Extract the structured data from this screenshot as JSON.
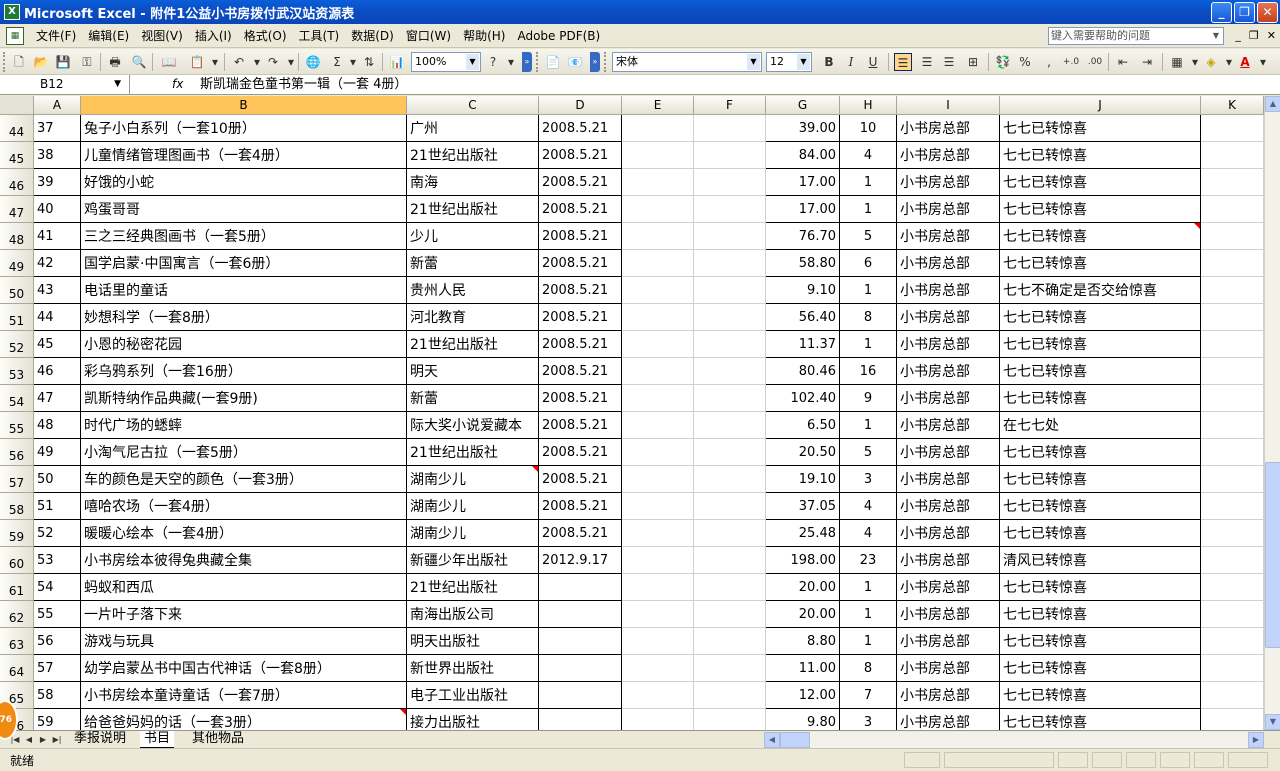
{
  "window": {
    "title": "Microsoft Excel - 附件1公益小书房拨付武汉站资源表",
    "app_icon": "X"
  },
  "menu": {
    "items": [
      "文件(F)",
      "编辑(E)",
      "视图(V)",
      "插入(I)",
      "格式(O)",
      "工具(T)",
      "数据(D)",
      "窗口(W)",
      "帮助(H)",
      "Adobe PDF(B)"
    ],
    "help_placeholder": "键入需要帮助的问题"
  },
  "toolbar": {
    "zoom": "100%",
    "font_name": "宋体",
    "font_size": "12",
    "bold": "B",
    "italic": "I",
    "underline": "U",
    "sum": "Σ",
    "percent": "%",
    "comma": ","
  },
  "formula_bar": {
    "name_box": "B12",
    "fx": "fx",
    "formula": "斯凯瑞金色童书第一辑（一套 4册）"
  },
  "columns": [
    "A",
    "B",
    "C",
    "D",
    "E",
    "F",
    "G",
    "H",
    "I",
    "J",
    "K"
  ],
  "selected_column": "B",
  "rows": [
    {
      "row": "44",
      "a": "37",
      "b": "兔子小白系列（一套10册）",
      "c": "广州",
      "d": "2008.5.21",
      "g": "39.00",
      "h": "10",
      "i": "小书房总部",
      "j": "七七已转惊喜"
    },
    {
      "row": "45",
      "a": "38",
      "b": "儿童情绪管理图画书（一套4册）",
      "c": "21世纪出版社",
      "d": "2008.5.21",
      "g": "84.00",
      "h": "4",
      "i": "小书房总部",
      "j": "七七已转惊喜"
    },
    {
      "row": "46",
      "a": "39",
      "b": "好饿的小蛇",
      "c": "南海",
      "d": "2008.5.21",
      "g": "17.00",
      "h": "1",
      "i": "小书房总部",
      "j": "七七已转惊喜"
    },
    {
      "row": "47",
      "a": "40",
      "b": "鸡蛋哥哥",
      "c": "21世纪出版社",
      "d": "2008.5.21",
      "g": "17.00",
      "h": "1",
      "i": "小书房总部",
      "j": "七七已转惊喜"
    },
    {
      "row": "48",
      "a": "41",
      "b": "三之三经典图画书（一套5册）",
      "c": "少儿",
      "d": "2008.5.21",
      "g": "76.70",
      "h": "5",
      "i": "小书房总部",
      "j": "七七已转惊喜"
    },
    {
      "row": "49",
      "a": "42",
      "b": "国学启蒙·中国寓言（一套6册）",
      "c": "新蕾",
      "d": "2008.5.21",
      "g": "58.80",
      "h": "6",
      "i": "小书房总部",
      "j": "七七已转惊喜"
    },
    {
      "row": "50",
      "a": "43",
      "b": "电话里的童话",
      "c": "贵州人民",
      "d": "2008.5.21",
      "g": "9.10",
      "h": "1",
      "i": "小书房总部",
      "j": "七七不确定是否交给惊喜"
    },
    {
      "row": "51",
      "a": "44",
      "b": "妙想科学（一套8册）",
      "c": "河北教育",
      "d": "2008.5.21",
      "g": "56.40",
      "h": "8",
      "i": "小书房总部",
      "j": "七七已转惊喜"
    },
    {
      "row": "52",
      "a": "45",
      "b": "小恩的秘密花园",
      "c": "21世纪出版社",
      "d": "2008.5.21",
      "g": "11.37",
      "h": "1",
      "i": "小书房总部",
      "j": "七七已转惊喜"
    },
    {
      "row": "53",
      "a": "46",
      "b": "彩乌鸦系列（一套16册）",
      "c": "明天",
      "d": "2008.5.21",
      "g": "80.46",
      "h": "16",
      "i": "小书房总部",
      "j": "七七已转惊喜"
    },
    {
      "row": "54",
      "a": "47",
      "b": "凯斯特纳作品典藏(一套9册)",
      "c": "新蕾",
      "d": "2008.5.21",
      "g": "102.40",
      "h": "9",
      "i": "小书房总部",
      "j": "七七已转惊喜"
    },
    {
      "row": "55",
      "a": "48",
      "b": "时代广场的蟋蟀",
      "c": "际大奖小说爱藏本",
      "d": "2008.5.21",
      "g": "6.50",
      "h": "1",
      "i": "小书房总部",
      "j": "在七七处"
    },
    {
      "row": "56",
      "a": "49",
      "b": "小淘气尼古拉（一套5册）",
      "c": "21世纪出版社",
      "d": "2008.5.21",
      "g": "20.50",
      "h": "5",
      "i": "小书房总部",
      "j": "七七已转惊喜"
    },
    {
      "row": "57",
      "a": "50",
      "b": "车的颜色是天空的颜色（一套3册）",
      "c": "湖南少儿",
      "d": "2008.5.21",
      "g": "19.10",
      "h": "3",
      "i": "小书房总部",
      "j": "七七已转惊喜"
    },
    {
      "row": "58",
      "a": "51",
      "b": "嘻哈农场（一套4册）",
      "c": "湖南少儿",
      "d": "2008.5.21",
      "g": "37.05",
      "h": "4",
      "i": "小书房总部",
      "j": "七七已转惊喜"
    },
    {
      "row": "59",
      "a": "52",
      "b": "暖暖心绘本（一套4册）",
      "c": "湖南少儿",
      "d": "2008.5.21",
      "g": "25.48",
      "h": "4",
      "i": "小书房总部",
      "j": "七七已转惊喜"
    },
    {
      "row": "60",
      "a": "53",
      "b": "小书房绘本彼得兔典藏全集",
      "c": "新疆少年出版社",
      "d": "2012.9.17",
      "g": "198.00",
      "h": "23",
      "i": "小书房总部",
      "j": "清风已转惊喜"
    },
    {
      "row": "61",
      "a": "54",
      "b": "蚂蚁和西瓜",
      "c": "21世纪出版社",
      "d": "",
      "g": "20.00",
      "h": "1",
      "i": "小书房总部",
      "j": "七七已转惊喜"
    },
    {
      "row": "62",
      "a": "55",
      "b": "一片叶子落下来",
      "c": "南海出版公司",
      "d": "",
      "g": "20.00",
      "h": "1",
      "i": "小书房总部",
      "j": "七七已转惊喜"
    },
    {
      "row": "63",
      "a": "56",
      "b": "游戏与玩具",
      "c": "明天出版社",
      "d": "",
      "g": "8.80",
      "h": "1",
      "i": "小书房总部",
      "j": "七七已转惊喜"
    },
    {
      "row": "64",
      "a": "57",
      "b": "幼学启蒙丛书中国古代神话（一套8册）",
      "c": "新世界出版社",
      "d": "",
      "g": "11.00",
      "h": "8",
      "i": "小书房总部",
      "j": "七七已转惊喜"
    },
    {
      "row": "65",
      "a": "58",
      "b": "小书房绘本童诗童话（一套7册）",
      "c": "电子工业出版社",
      "d": "",
      "g": "12.00",
      "h": "7",
      "i": "小书房总部",
      "j": "七七已转惊喜"
    },
    {
      "row": "66",
      "a": "59",
      "b": "给爸爸妈妈的话（一套3册）",
      "c": "接力出版社",
      "d": "",
      "g": "9.80",
      "h": "3",
      "i": "小书房总部",
      "j": "七七已转惊喜"
    }
  ],
  "sheet_tabs": [
    "季报说明",
    "书目",
    "其他物品"
  ],
  "active_tab": "书目",
  "status": {
    "text": "就绪"
  },
  "bubble_text": "76"
}
